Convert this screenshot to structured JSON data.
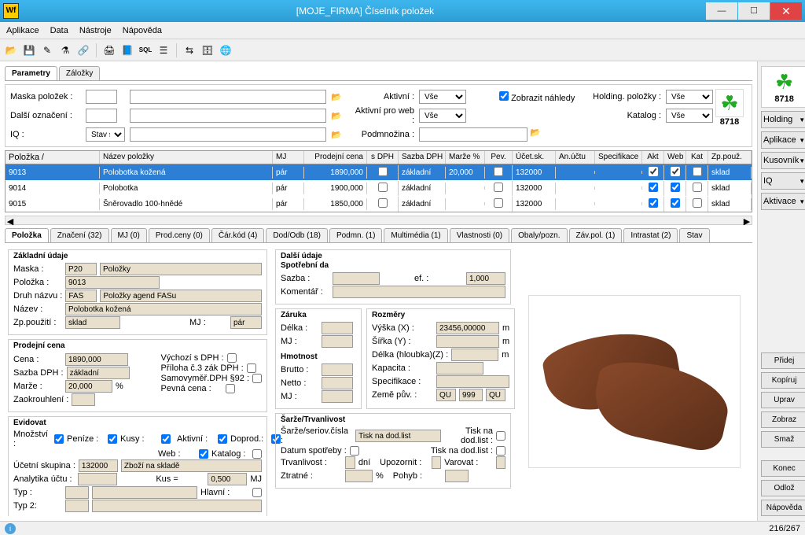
{
  "window": {
    "title": "[MOJE_FIRMA] Číselník položek",
    "app_icon": "Wf"
  },
  "menu": {
    "aplikace": "Aplikace",
    "data": "Data",
    "nastroje": "Nástroje",
    "napoveda": "Nápověda"
  },
  "tabs_top": {
    "parametry": "Parametry",
    "zalozky": "Záložky"
  },
  "filters": {
    "maska": "Maska položek :",
    "dalsi": "Další označení :",
    "iq": "IQ :",
    "iq_val": "Stav skladu",
    "aktivni": "Aktivní :",
    "aktivni_val": "Vše",
    "aktivni_web": "Aktivní pro web :",
    "aktivni_web_val": "Vše",
    "podmnozina": "Podmnožina :",
    "zobrazit": "Zobrazit náhledy",
    "holding": "Holding. položky :",
    "holding_val": "Vše",
    "katalog": "Katalog :",
    "katalog_val": "Vše",
    "count": "8718"
  },
  "grid": {
    "headers": {
      "polozka": "Položka",
      "nazev": "Název položky",
      "mj": "MJ",
      "prodej": "Prodejní cena",
      "sdph": "s DPH",
      "sazba": "Sazba DPH",
      "marze": "Marže %",
      "pev": "Pev.",
      "ucet": "Účet.sk.",
      "an": "An.účtu",
      "spec": "Specifikace",
      "akt": "Akt",
      "web": "Web",
      "kat": "Kat",
      "zp": "Zp.použ."
    },
    "sort_indicator": "/",
    "rows": [
      {
        "pol": "9013",
        "naz": "Polobotka kožená",
        "mj": "pár",
        "pc": "1890,000",
        "sdph": false,
        "sazba": "základní",
        "marze": "20,000",
        "pev": false,
        "ucet": "132000",
        "akt": true,
        "web": true,
        "kat": false,
        "zp": "sklad",
        "sel": true
      },
      {
        "pol": "9014",
        "naz": "Polobotka",
        "mj": "pár",
        "pc": "1900,000",
        "sdph": false,
        "sazba": "základní",
        "marze": "",
        "pev": false,
        "ucet": "132000",
        "akt": true,
        "web": true,
        "kat": false,
        "zp": "sklad",
        "sel": false
      },
      {
        "pol": "9015",
        "naz": "Šněrovadlo 100-hnědé",
        "mj": "pár",
        "pc": "1850,000",
        "sdph": false,
        "sazba": "základní",
        "marze": "",
        "pev": false,
        "ucet": "132000",
        "akt": true,
        "web": true,
        "kat": false,
        "zp": "sklad",
        "sel": false
      }
    ]
  },
  "detail_tabs": {
    "polozka": "Položka",
    "znaceni": "Značení (32)",
    "mj": "MJ (0)",
    "prod": "Prod.ceny (0)",
    "car": "Čár.kód (4)",
    "dod": "Dod/Odb (18)",
    "podmn": "Podmn. (1)",
    "multi": "Multimédia (1)",
    "vlast": "Vlastnosti (0)",
    "obaly": "Obaly/pozn.",
    "zav": "Záv.pol. (1)",
    "intr": "Intrastat (2)",
    "stav": "Stav"
  },
  "detail": {
    "zakladni": "Základní údaje",
    "maska_l": "Maska :",
    "maska_c": "P20",
    "maska_t": "Položky",
    "polozka_l": "Položka :",
    "polozka_v": "9013",
    "druh_l": "Druh názvu :",
    "druh_c": "FAS",
    "druh_t": "Položky agend FASu",
    "nazev_l": "Název :",
    "nazev_v": "Polobotka kožená",
    "zp_l": "Zp.použití :",
    "zp_v": "sklad",
    "mj_l": "MJ :",
    "mj_v": "pár",
    "prodej_t": "Prodejní cena",
    "cena_l": "Cena :",
    "cena_v": "1890,000",
    "sazba_l": "Sazba DPH :",
    "sazba_v": "základní",
    "marze_l": "Marže :",
    "marze_v": "20,000",
    "marze_u": "%",
    "zaok_l": "Zaokrouhlení :",
    "vychozi": "Výchozí s DPH :",
    "priloha": "Příloha č.3 zák DPH :",
    "samo": "Samovyměř.DPH §92 :",
    "pevna": "Pevná cena :",
    "evidovat": "Evidovat",
    "mnoz": "Množství :",
    "penize": "Peníze :",
    "kusy": "Kusy :",
    "aktivni": "Aktivní :",
    "doprod": "Doprod.:",
    "web": "Web :",
    "katalog": "Katalog :",
    "ucetni_l": "Účetní skupina :",
    "ucetni_c": "132000",
    "ucetni_t": "Zboží na skladě",
    "analyt_l": "Analytika účtu :",
    "kus_l": "Kus =",
    "kus_v": "0,500",
    "kus_u": "MJ",
    "typ_l": "Typ :",
    "typ2_l": "Typ 2:",
    "hlavni": "Hlavní :",
    "dalsi_t": "Další údaje",
    "spotr_t": "Spotřební da",
    "sazba2_l": "Sazba :",
    "ef_l": "ef. :",
    "ef_v": "1,000",
    "komentar_l": "Komentář :",
    "zaruka_t": "Záruka",
    "delka_l": "Délka :",
    "mj2_l": "MJ :",
    "rozmery_t": "Rozměry",
    "vyska_l": "Výška (X) :",
    "vyska_v": "23456,00000",
    "m": "m",
    "sirka_l": "Šířka (Y) :",
    "delka2_l": "Délka (hloubka)(Z) :",
    "kapacita_l": "Kapacita :",
    "hmotnost_t": "Hmotnost",
    "brutto_l": "Brutto :",
    "netto_l": "Netto :",
    "mj3_l": "MJ :",
    "spec_l": "Specifikace :",
    "zeme_l": "Země pův. :",
    "zeme_c": "QU",
    "zeme_n": "999",
    "zeme_t": "QU",
    "sarze_t": "Šarže/Trvanlivost",
    "sarze_l": "Šarže/seriov.čísla :",
    "sarze_v": "Tisk na dod.list",
    "tisk1": "Tisk na dod.list :",
    "tisk2": "Tisk na dod.list :",
    "datum_l": "Datum spotřeby :",
    "trvan_l": "Trvanlivost :",
    "dni": "dní",
    "upoz": "Upozornit :",
    "varov": "Varovat :",
    "ztratne_l": "Ztratné :",
    "pct": "%",
    "pohyb_l": "Pohyb :"
  },
  "sidebar": {
    "holding": "Holding",
    "aplikace": "Aplikace",
    "kusovnik": "Kusovník",
    "iq": "IQ",
    "aktivace": "Aktivace",
    "pridej": "Přidej",
    "kopiruj": "Kopíruj",
    "uprav": "Uprav",
    "zobraz": "Zobraz",
    "smaz": "Smaž",
    "konec": "Konec",
    "odloz": "Odlož",
    "napoveda": "Nápověda"
  },
  "status": {
    "pages": "216/267"
  }
}
